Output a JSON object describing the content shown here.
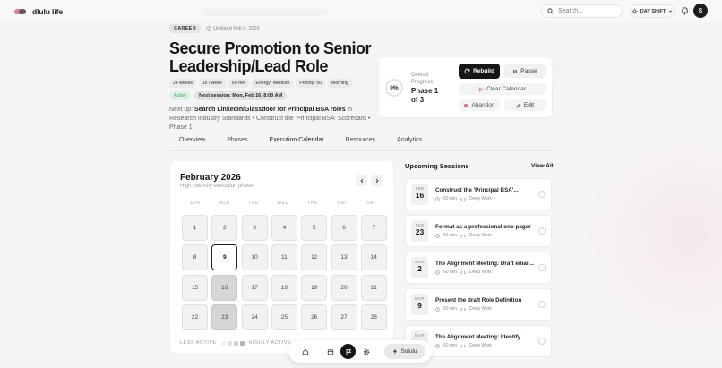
{
  "app": {
    "name": "dlulu life"
  },
  "topbar": {
    "search_placeholder": "Search...",
    "dayshift_label": "DAY SHIFT",
    "avatar_initial": "S"
  },
  "goal": {
    "category": "CAREER",
    "updated": "Updated Feb 9, 2026",
    "title": "Secure Promotion to Senior Leadership/Lead Role",
    "meta": [
      "24 weeks",
      "1x / week",
      "60 min",
      "Energy: Medium",
      "Priority: 50",
      "Morning"
    ],
    "status": "Active",
    "next_session": "Next session: Mon, Feb 16, 8:00 AM",
    "next_up_prefix": "Next up:",
    "next_up_task": "Search LinkedIn/Glassdoor for Principal BSA roles",
    "next_up_rest": "in Research Industry Standards • Construct the 'Principal BSA' Scorecard • Phase 1"
  },
  "progress": {
    "percent": "0%",
    "label": "Overall Progress",
    "phase": "Phase 1 of 3",
    "rebuild": "Rebuild",
    "pause": "Pause",
    "clear_calendar": "Clear Calendar",
    "abandon": "Abandon",
    "edit": "Edit"
  },
  "tabs": [
    "Overview",
    "Phases",
    "Execution Calendar",
    "Resources",
    "Analytics"
  ],
  "active_tab": "Execution Calendar",
  "calendar": {
    "month": "February 2026",
    "subtitle": "High intensity execution phase",
    "weekdays": [
      "SUN",
      "MON",
      "TUE",
      "WED",
      "THU",
      "FRI",
      "SAT"
    ],
    "days": [
      1,
      2,
      3,
      4,
      5,
      6,
      7,
      8,
      9,
      10,
      11,
      12,
      13,
      14,
      15,
      16,
      17,
      18,
      19,
      20,
      21,
      22,
      23,
      24,
      25,
      26,
      27,
      28
    ],
    "today": 9,
    "session_days": [
      16,
      23
    ],
    "legend_less": "LESS ACTIVE",
    "legend_more": "HIGHLY ACTIVE",
    "legend_colors": [
      "#f1f1f3",
      "#e2e2e5",
      "#cfcfd3",
      "#b5b5ba"
    ]
  },
  "upcoming": {
    "title": "Upcoming Sessions",
    "view_all": "View All",
    "sessions": [
      {
        "month": "FEB",
        "day": "16",
        "title": "Construct the 'Principal BSA'...",
        "duration": "60 min",
        "type": "Deep Work"
      },
      {
        "month": "FEB",
        "day": "23",
        "title": "Format as a professional one-pager",
        "duration": "60 min",
        "type": "Deep Work"
      },
      {
        "month": "MAR",
        "day": "2",
        "title": "The Alignment Meeting: Draft email...",
        "duration": "60 min",
        "type": "Deep Work"
      },
      {
        "month": "MAR",
        "day": "9",
        "title": "Present the draft Role Definition",
        "duration": "60 min",
        "type": "Deep Work"
      },
      {
        "month": "MAR",
        "day": "",
        "title": "The Alignment Meeting: Identify...",
        "duration": "60 min",
        "type": "Deep Work"
      }
    ]
  },
  "dock": {
    "solulu_label": "Solulu"
  }
}
